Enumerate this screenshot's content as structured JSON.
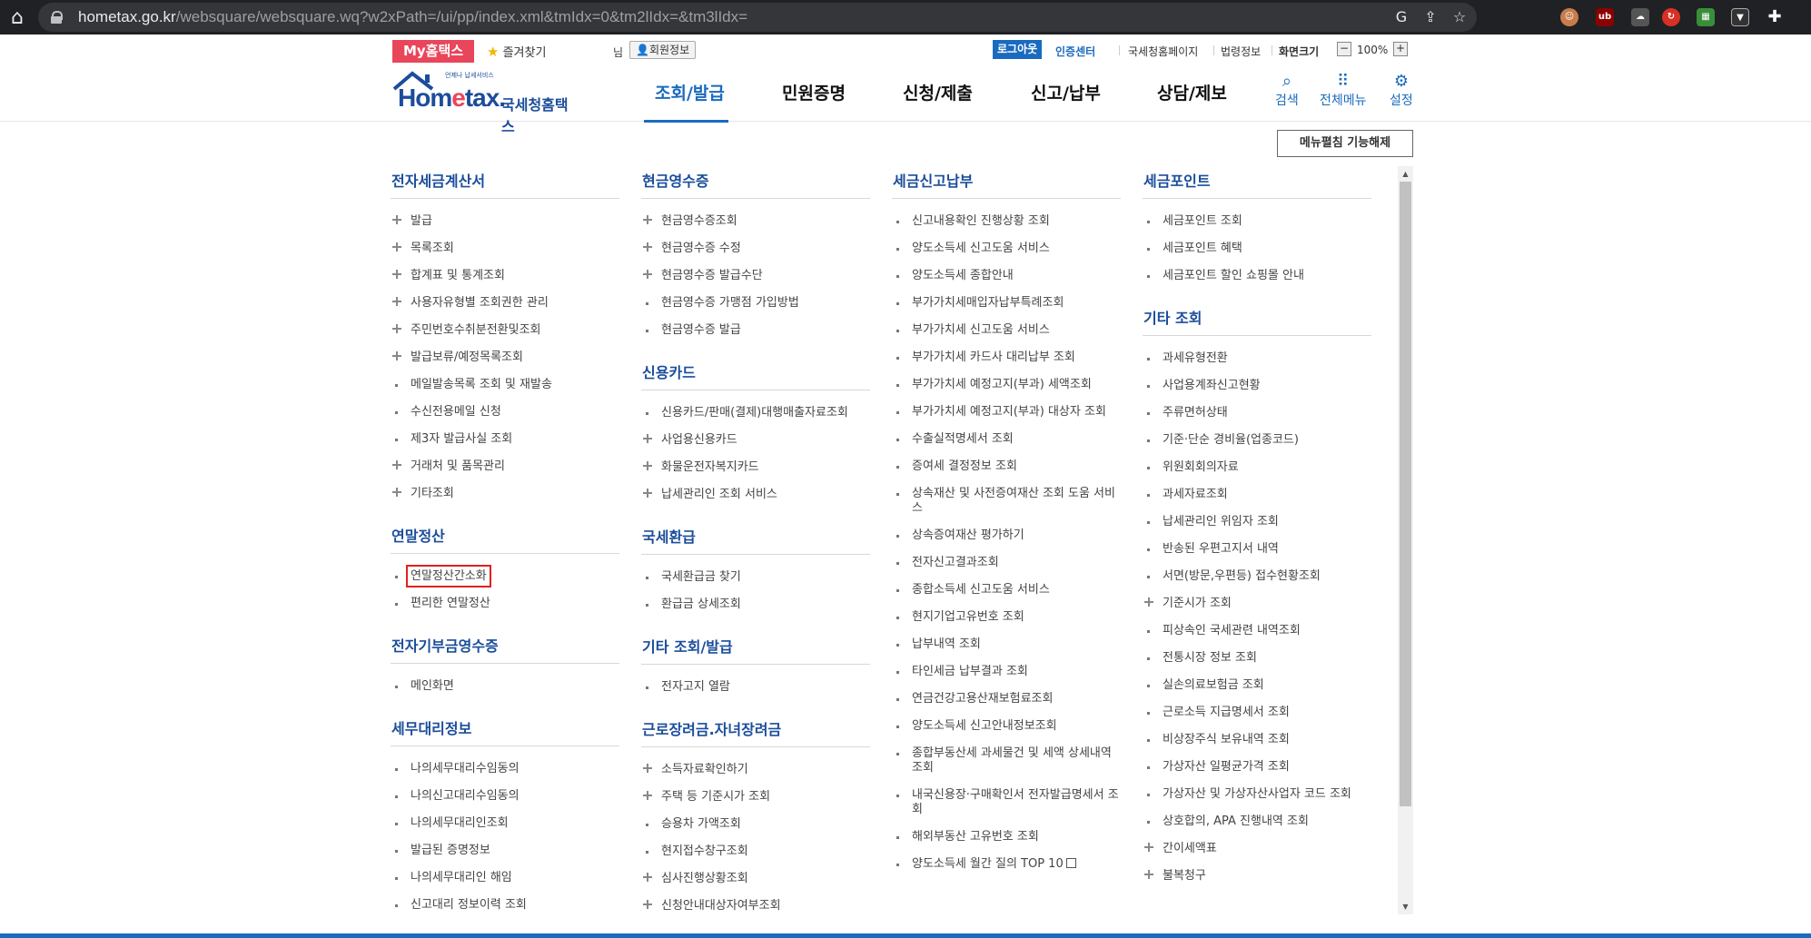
{
  "browser": {
    "url_host": "hometax.go.kr",
    "url_path": "/websquare/websquare.wq?w2xPath=/ui/pp/index.xml&tmIdx=0&tm2lIdx=&tm3lIdx="
  },
  "utility": {
    "my_hometax": "My홈택스",
    "favorites": "즐겨찾기",
    "user_suffix": "님",
    "member_info": "회원정보",
    "logout": "로그아웃",
    "cert_center": "인증센터",
    "links": [
      "국세청홈페이지",
      "법령정보",
      "화면크기"
    ],
    "zoom": "100%",
    "zoom_minus": "−",
    "zoom_plus": "+"
  },
  "logo": {
    "text_home": "Hom",
    "text_e": "e",
    "text_tax": "tax.",
    "tagline": "언제나 납세서비스",
    "korean": "국세청홈택스"
  },
  "gnb": [
    "조회/발급",
    "민원증명",
    "신청/제출",
    "신고/납부",
    "상담/제보"
  ],
  "top_icons": {
    "search": "검색",
    "all_menu": "전체메뉴",
    "settings": "설정"
  },
  "fold_button": "메뉴펼침 기능해제",
  "columns": [
    {
      "sections": [
        {
          "title": "전자세금계산서",
          "items": [
            {
              "label": "발급",
              "mark": "plus"
            },
            {
              "label": "목록조회",
              "mark": "plus"
            },
            {
              "label": "합계표 및 통계조회",
              "mark": "plus"
            },
            {
              "label": "사용자유형별 조회권한 관리",
              "mark": "plus"
            },
            {
              "label": "주민번호수취분전환및조회",
              "mark": "plus"
            },
            {
              "label": "발급보류/예정목록조회",
              "mark": "plus"
            },
            {
              "label": "메일발송목록 조회 및 재발송",
              "mark": "dot"
            },
            {
              "label": "수신전용메일 신청",
              "mark": "dot"
            },
            {
              "label": "제3자 발급사실 조회",
              "mark": "dot"
            },
            {
              "label": "거래처 및 품목관리",
              "mark": "plus"
            },
            {
              "label": "기타조회",
              "mark": "plus"
            }
          ]
        },
        {
          "title": "연말정산",
          "items": [
            {
              "label": "연말정산간소화",
              "mark": "dot",
              "highlight": true
            },
            {
              "label": "편리한 연말정산",
              "mark": "dot"
            }
          ]
        },
        {
          "title": "전자기부금영수증",
          "items": [
            {
              "label": "메인화면",
              "mark": "dot"
            }
          ]
        },
        {
          "title": "세무대리정보",
          "items": [
            {
              "label": "나의세무대리수임동의",
              "mark": "dot"
            },
            {
              "label": "나의신고대리수임동의",
              "mark": "dot"
            },
            {
              "label": "나의세무대리인조회",
              "mark": "dot"
            },
            {
              "label": "발급된 증명정보",
              "mark": "dot"
            },
            {
              "label": "나의세무대리인 해임",
              "mark": "dot"
            },
            {
              "label": "신고대리 정보이력 조회",
              "mark": "dot"
            }
          ]
        }
      ]
    },
    {
      "sections": [
        {
          "title": "현금영수증",
          "items": [
            {
              "label": "현금영수증조회",
              "mark": "plus"
            },
            {
              "label": "현금영수증 수정",
              "mark": "plus"
            },
            {
              "label": "현금영수증 발급수단",
              "mark": "plus"
            },
            {
              "label": "현금영수증 가맹점 가입방법",
              "mark": "dot"
            },
            {
              "label": "현금영수증 발급",
              "mark": "dot"
            }
          ]
        },
        {
          "title": "신용카드",
          "items": [
            {
              "label": "신용카드/판매(결제)대행매출자료조회",
              "mark": "dot"
            },
            {
              "label": "사업용신용카드",
              "mark": "plus"
            },
            {
              "label": "화물운전자복지카드",
              "mark": "plus"
            },
            {
              "label": "납세관리인 조회 서비스",
              "mark": "plus"
            }
          ]
        },
        {
          "title": "국세환급",
          "items": [
            {
              "label": "국세환급금 찾기",
              "mark": "dot"
            },
            {
              "label": "환급금 상세조회",
              "mark": "dot"
            }
          ]
        },
        {
          "title": "기타 조회/발급",
          "items": [
            {
              "label": "전자고지 열람",
              "mark": "dot"
            }
          ]
        },
        {
          "title": "근로장려금.자녀장려금",
          "items": [
            {
              "label": "소득자료확인하기",
              "mark": "plus"
            },
            {
              "label": "주택 등 기준시가 조회",
              "mark": "plus"
            },
            {
              "label": "승용차 가액조회",
              "mark": "dot"
            },
            {
              "label": "현지접수창구조회",
              "mark": "dot"
            },
            {
              "label": "심사진행상황조회",
              "mark": "plus"
            },
            {
              "label": "신청안내대상자여부조회",
              "mark": "plus"
            }
          ]
        }
      ]
    },
    {
      "sections": [
        {
          "title": "세금신고납부",
          "items": [
            {
              "label": "신고내용확인 진행상황 조회",
              "mark": "dot"
            },
            {
              "label": "양도소득세 신고도움 서비스",
              "mark": "dot"
            },
            {
              "label": "양도소득세 종합안내",
              "mark": "dot"
            },
            {
              "label": "부가가치세매입자납부특례조회",
              "mark": "dot"
            },
            {
              "label": "부가가치세 신고도움 서비스",
              "mark": "dot"
            },
            {
              "label": "부가가치세 카드사 대리납부 조회",
              "mark": "dot"
            },
            {
              "label": "부가가치세 예정고지(부과) 세액조회",
              "mark": "dot"
            },
            {
              "label": "부가가치세 예정고지(부과) 대상자 조회",
              "mark": "dot"
            },
            {
              "label": "수출실적명세서 조회",
              "mark": "dot"
            },
            {
              "label": "증여세 결정정보 조회",
              "mark": "dot"
            },
            {
              "label": "상속재산 및 사전증여재산 조회 도움 서비스",
              "mark": "dot"
            },
            {
              "label": "상속증여재산 평가하기",
              "mark": "dot"
            },
            {
              "label": "전자신고결과조회",
              "mark": "dot"
            },
            {
              "label": "종합소득세 신고도움 서비스",
              "mark": "dot"
            },
            {
              "label": "현지기업고유번호 조회",
              "mark": "dot"
            },
            {
              "label": "납부내역 조회",
              "mark": "dot"
            },
            {
              "label": "타인세금 납부결과 조회",
              "mark": "dot"
            },
            {
              "label": "연금건강고용산재보험료조회",
              "mark": "dot"
            },
            {
              "label": "양도소득세 신고안내정보조회",
              "mark": "dot"
            },
            {
              "label": "종합부동산세 과세물건 및 세액 상세내역 조회",
              "mark": "dot"
            },
            {
              "label": "내국신용장·구매확인서 전자발급명세서 조회",
              "mark": "dot"
            },
            {
              "label": "해외부동산 고유번호 조회",
              "mark": "dot"
            },
            {
              "label": "양도소득세 월간 질의 TOP 10",
              "mark": "dot",
              "external": true
            }
          ]
        }
      ]
    },
    {
      "sections": [
        {
          "title": "세금포인트",
          "items": [
            {
              "label": "세금포인트 조회",
              "mark": "dot"
            },
            {
              "label": "세금포인트 혜택",
              "mark": "dot"
            },
            {
              "label": "세금포인트 할인 쇼핑몰 안내",
              "mark": "dot"
            }
          ]
        },
        {
          "title": "기타 조회",
          "items": [
            {
              "label": "과세유형전환",
              "mark": "dot"
            },
            {
              "label": "사업용계좌신고현황",
              "mark": "dot"
            },
            {
              "label": "주류면허상태",
              "mark": "dot"
            },
            {
              "label": "기준·단순 경비율(업종코드)",
              "mark": "dot"
            },
            {
              "label": "위원회회의자료",
              "mark": "dot"
            },
            {
              "label": "과세자료조회",
              "mark": "dot"
            },
            {
              "label": "납세관리인 위임자 조회",
              "mark": "dot"
            },
            {
              "label": "반송된 우편고지서 내역",
              "mark": "dot"
            },
            {
              "label": "서면(방문,우편등) 접수현황조회",
              "mark": "dot"
            },
            {
              "label": "기준시가 조회",
              "mark": "plus"
            },
            {
              "label": "피상속인 국세관련 내역조회",
              "mark": "dot"
            },
            {
              "label": "전통시장 정보 조회",
              "mark": "dot"
            },
            {
              "label": "실손의료보험금 조회",
              "mark": "dot"
            },
            {
              "label": "근로소득 지급명세서 조회",
              "mark": "dot"
            },
            {
              "label": "비상장주식 보유내역 조회",
              "mark": "dot"
            },
            {
              "label": "가상자산 일평균가격 조회",
              "mark": "dot"
            },
            {
              "label": "가상자산 및 가상자산사업자 코드 조회",
              "mark": "dot"
            },
            {
              "label": "상호합의, APA 진행내역 조회",
              "mark": "dot"
            },
            {
              "label": "간이세액표",
              "mark": "plus"
            },
            {
              "label": "불복청구",
              "mark": "plus"
            }
          ]
        }
      ]
    }
  ],
  "colors": {
    "brand_blue": "#1b4d9b",
    "accent_blue": "#1a6bbf",
    "my_red": "#e9465b",
    "highlight_red": "#e02020"
  }
}
